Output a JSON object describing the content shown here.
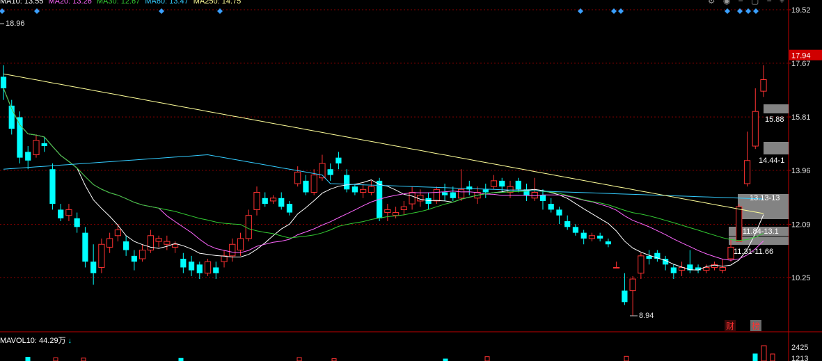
{
  "ma_legend": [
    {
      "label": "MA10: 13.55",
      "color": "#ffffff"
    },
    {
      "label": "MA20: 13.26",
      "color": "#ff66ff"
    },
    {
      "label": "MA30: 12.67",
      "color": "#33cc33"
    },
    {
      "label": "MA60: 13.47",
      "color": "#33ccff"
    },
    {
      "label": "MA250: 14.75",
      "color": "#ffff99"
    }
  ],
  "vol_legend": "MAVOL10: 44.29万",
  "toolbar_icons": [
    "gear-icon",
    "eye-icon",
    "minus-icon",
    "square-icon",
    "minus-icon",
    "plus-icon"
  ],
  "price_axis": [
    "19.52",
    "17.67",
    "15.81",
    "13.96",
    "12.09",
    "10.25"
  ],
  "current_price": "17.94",
  "vol_axis": [
    "2425",
    "1213"
  ],
  "annotations": {
    "high": "18.96",
    "low": "8.94",
    "zone1": "15.88",
    "zone2": "14.44-1",
    "zone3": "13.13-13",
    "zone4": "11.84-13.1",
    "zone5": "11.31-11.66"
  },
  "markers": {
    "cai": "财",
    "bang": "榜"
  },
  "colors": {
    "up": "#ff3232",
    "down": "#00ffff",
    "grid": "#8b0000",
    "axis": "#c00000"
  },
  "chart_data": {
    "type": "candlestick",
    "ylim": [
      8.4,
      19.9
    ],
    "ticks": [
      19.52,
      17.67,
      15.81,
      13.96,
      12.09,
      10.25
    ],
    "candles": [
      [
        17.2,
        16.8,
        17.6,
        16.4
      ],
      [
        16.2,
        15.4,
        16.4,
        15.2
      ],
      [
        15.8,
        14.4,
        16.0,
        14.2
      ],
      [
        14.6,
        14.3,
        14.8,
        14.0
      ],
      [
        14.5,
        15.0,
        15.2,
        14.4
      ],
      [
        14.9,
        14.8,
        15.1,
        14.6
      ],
      [
        14.0,
        12.8,
        14.2,
        12.6
      ],
      [
        12.6,
        12.3,
        12.8,
        12.2
      ],
      [
        12.4,
        12.6,
        12.8,
        12.2
      ],
      [
        12.3,
        12.0,
        12.5,
        11.8
      ],
      [
        11.8,
        10.8,
        12.0,
        10.6
      ],
      [
        10.8,
        10.4,
        11.4,
        10.0
      ],
      [
        10.6,
        11.4,
        11.6,
        10.4
      ],
      [
        11.3,
        11.6,
        11.8,
        11.1
      ],
      [
        11.7,
        11.9,
        12.1,
        11.5
      ],
      [
        11.5,
        11.2,
        11.7,
        11.0
      ],
      [
        11.0,
        10.8,
        11.2,
        10.5
      ],
      [
        10.9,
        11.2,
        11.4,
        10.8
      ],
      [
        11.2,
        11.7,
        11.9,
        11.1
      ],
      [
        11.5,
        11.6,
        11.7,
        11.3
      ],
      [
        11.4,
        11.5,
        11.7,
        11.2
      ],
      [
        11.3,
        11.4,
        11.5,
        11.1
      ],
      [
        10.9,
        10.6,
        11.1,
        10.4
      ],
      [
        10.8,
        10.5,
        11.0,
        10.3
      ],
      [
        10.7,
        10.4,
        10.8,
        10.2
      ],
      [
        10.4,
        10.8,
        10.9,
        10.3
      ],
      [
        10.6,
        10.4,
        10.8,
        10.2
      ],
      [
        10.8,
        11.0,
        11.2,
        10.6
      ],
      [
        11.0,
        11.4,
        11.6,
        10.8
      ],
      [
        11.2,
        11.6,
        11.8,
        11.0
      ],
      [
        11.6,
        12.4,
        12.6,
        11.5
      ],
      [
        12.6,
        13.2,
        13.4,
        12.4
      ],
      [
        13.0,
        12.8,
        13.2,
        12.7
      ],
      [
        12.9,
        13.0,
        13.1,
        12.8
      ],
      [
        13.0,
        12.7,
        13.2,
        12.6
      ],
      [
        12.8,
        12.5,
        12.9,
        12.4
      ],
      [
        13.5,
        13.9,
        14.1,
        13.4
      ],
      [
        13.6,
        13.2,
        13.8,
        13.1
      ],
      [
        13.2,
        13.8,
        14.0,
        13.1
      ],
      [
        13.7,
        14.2,
        14.5,
        13.6
      ],
      [
        14.0,
        13.8,
        14.2,
        13.6
      ],
      [
        14.4,
        14.2,
        14.6,
        14.0
      ],
      [
        13.8,
        13.3,
        14.0,
        13.2
      ],
      [
        13.4,
        13.2,
        13.5,
        13.1
      ],
      [
        13.2,
        13.3,
        13.5,
        13.0
      ],
      [
        13.2,
        13.4,
        13.6,
        13.1
      ],
      [
        13.6,
        12.3,
        13.7,
        12.2
      ],
      [
        12.5,
        12.6,
        12.8,
        12.2
      ],
      [
        12.4,
        12.5,
        12.7,
        12.3
      ],
      [
        12.6,
        12.7,
        12.9,
        12.4
      ],
      [
        12.8,
        13.2,
        13.4,
        12.6
      ],
      [
        12.9,
        13.1,
        13.3,
        12.7
      ],
      [
        13.0,
        12.8,
        13.2,
        12.6
      ],
      [
        12.9,
        13.3,
        13.4,
        12.8
      ],
      [
        13.2,
        13.1,
        13.5,
        12.9
      ],
      [
        13.2,
        13.0,
        13.4,
        12.9
      ],
      [
        13.0,
        13.3,
        14.0,
        12.9
      ],
      [
        13.4,
        13.3,
        13.6,
        13.1
      ],
      [
        13.0,
        13.2,
        13.4,
        12.8
      ],
      [
        13.3,
        13.2,
        13.5,
        13.0
      ],
      [
        13.4,
        13.6,
        13.8,
        13.3
      ],
      [
        13.6,
        13.4,
        13.7,
        13.2
      ],
      [
        13.2,
        13.4,
        13.6,
        13.0
      ],
      [
        13.6,
        13.3,
        13.7,
        13.2
      ],
      [
        13.3,
        13.1,
        13.5,
        12.9
      ],
      [
        13.0,
        13.2,
        13.7,
        12.9
      ],
      [
        13.1,
        12.9,
        13.3,
        12.6
      ],
      [
        12.8,
        12.6,
        13.0,
        12.5
      ],
      [
        12.6,
        12.4,
        12.7,
        12.1
      ],
      [
        12.2,
        12.0,
        12.4,
        11.9
      ],
      [
        12.0,
        11.8,
        12.1,
        11.7
      ],
      [
        11.8,
        11.6,
        11.9,
        11.4
      ],
      [
        11.6,
        11.7,
        11.8,
        11.5
      ],
      [
        11.7,
        11.6,
        11.8,
        11.5
      ],
      [
        11.5,
        11.4,
        11.6,
        11.3
      ],
      [
        10.6,
        10.6,
        10.8,
        10.6
      ],
      [
        9.8,
        9.4,
        10.4,
        9.3
      ],
      [
        9.8,
        10.2,
        10.3,
        8.94
      ],
      [
        10.4,
        11.0,
        11.1,
        10.2
      ],
      [
        11.0,
        10.9,
        11.2,
        10.7
      ],
      [
        11.1,
        10.9,
        11.2,
        10.8
      ],
      [
        10.9,
        10.7,
        11.0,
        10.5
      ],
      [
        10.6,
        10.4,
        10.7,
        10.2
      ],
      [
        10.5,
        10.6,
        10.8,
        10.3
      ],
      [
        10.7,
        10.5,
        11.2,
        10.4
      ],
      [
        10.6,
        10.5,
        10.7,
        10.4
      ],
      [
        10.5,
        10.6,
        10.7,
        10.4
      ],
      [
        10.6,
        10.7,
        10.8,
        10.5
      ],
      [
        10.5,
        10.6,
        10.9,
        10.4
      ],
      [
        10.9,
        11.3,
        11.6,
        10.8
      ],
      [
        11.5,
        12.7,
        12.8,
        11.5
      ],
      [
        13.5,
        14.3,
        15.3,
        13.4
      ],
      [
        14.8,
        16.0,
        16.8,
        14.7
      ],
      [
        16.7,
        17.1,
        17.6,
        16.5
      ]
    ],
    "ma_series": [
      {
        "name": "MA10",
        "color": "#ffffff"
      },
      {
        "name": "MA20",
        "color": "#ff66ff"
      },
      {
        "name": "MA30",
        "color": "#33cc33"
      },
      {
        "name": "MA60",
        "color": "#33ccff"
      },
      {
        "name": "MA250",
        "color": "#ffff99"
      }
    ],
    "volumes": [
      1300,
      1100,
      1000,
      900,
      1200,
      800,
      700,
      1500,
      1600,
      2425,
      2000,
      2400
    ]
  }
}
